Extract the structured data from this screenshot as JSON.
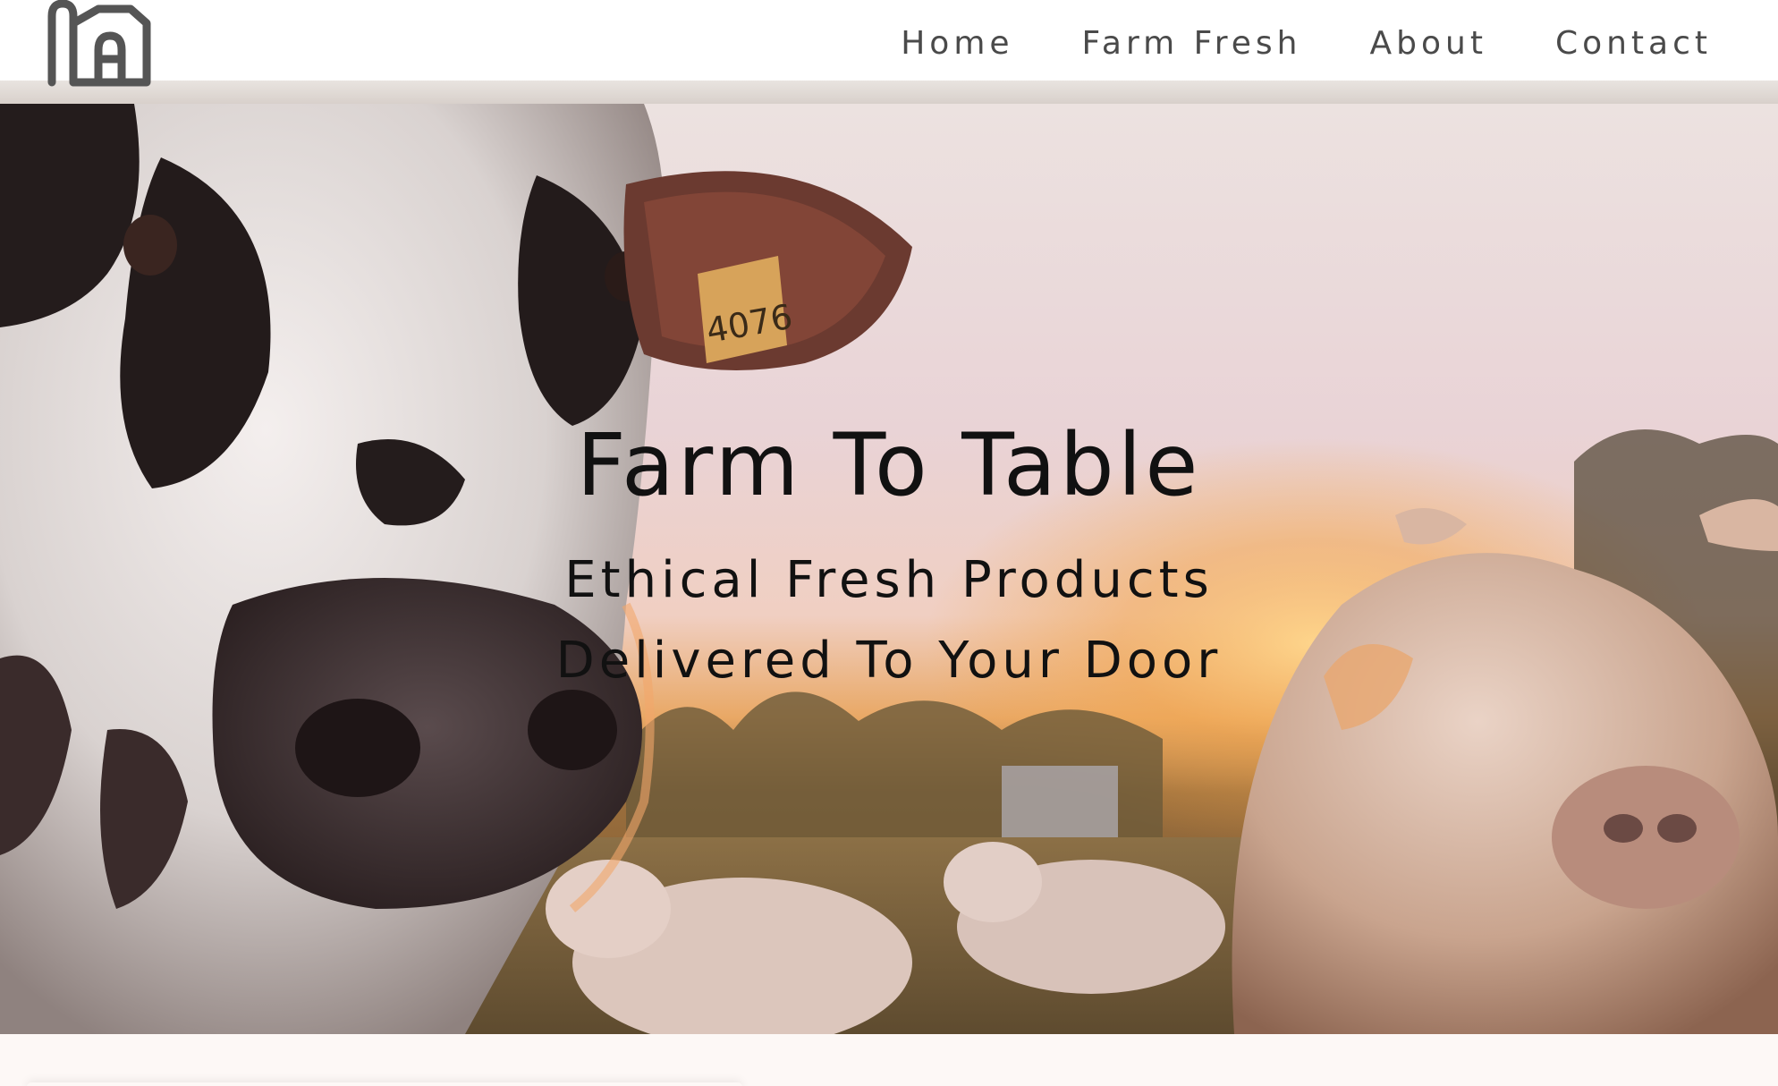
{
  "header": {
    "logo_icon": "barn-a-icon",
    "nav": [
      {
        "label": "Home"
      },
      {
        "label": "Farm Fresh"
      },
      {
        "label": "About"
      },
      {
        "label": "Contact"
      }
    ]
  },
  "hero": {
    "title": "Farm To Table",
    "subtitle_line1": "Ethical Fresh Products",
    "subtitle_line2": "Delivered To Your Door",
    "image_description_icon": "cows-sunset-photo",
    "ear_tag": "4076"
  },
  "colors": {
    "nav_text": "#4a4a4a",
    "hero_text": "#111111",
    "page_bg": "#ffffff",
    "below_bg": "#fdf8f6"
  }
}
